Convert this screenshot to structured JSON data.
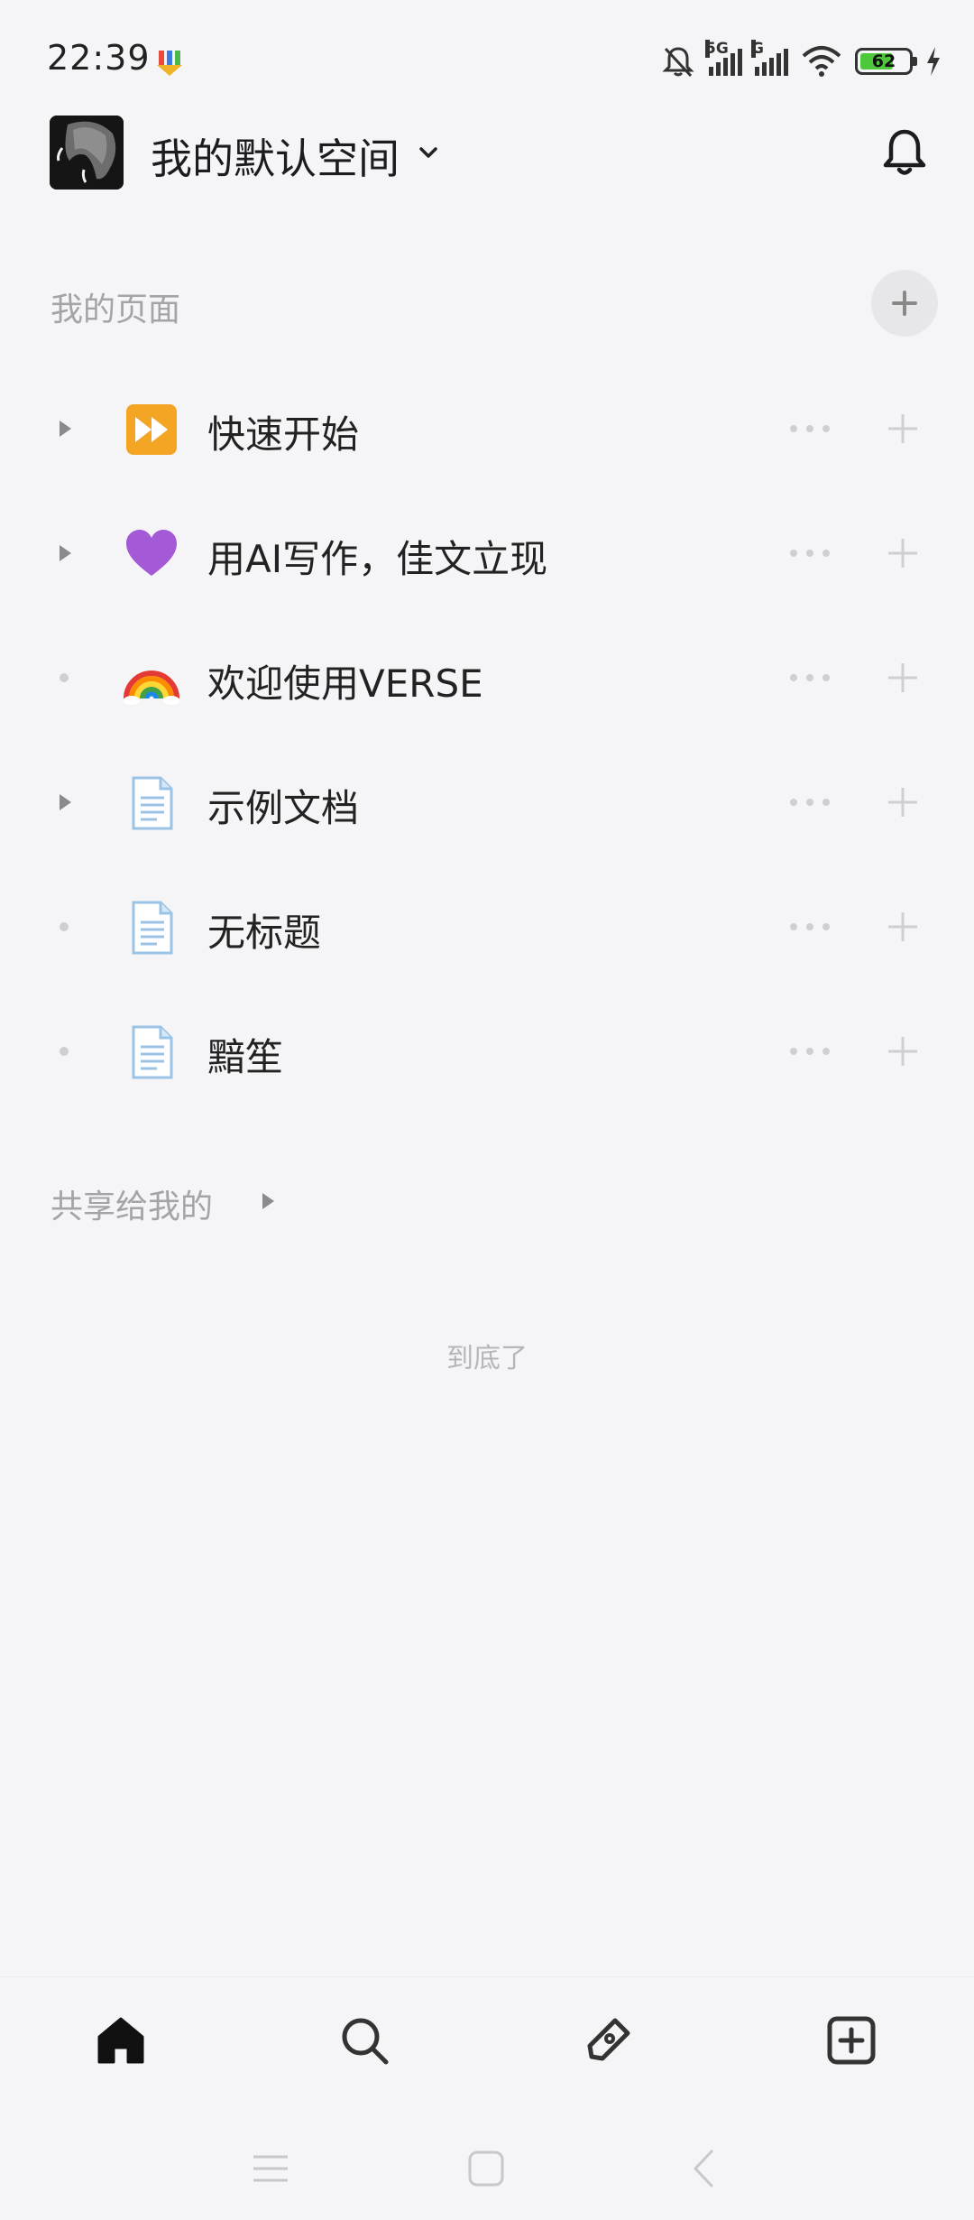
{
  "status_bar": {
    "time": "22:39",
    "network_1": "5G",
    "network_2": "G",
    "battery_level": "62",
    "icons": [
      "app-notification-icon",
      "mute-bell-icon",
      "signal-icon",
      "wifi-icon",
      "battery-icon",
      "charging-icon"
    ]
  },
  "header": {
    "space_name": "我的默认空间",
    "icons": [
      "avatar",
      "chevron-down-icon",
      "bell-icon"
    ]
  },
  "my_pages": {
    "label": "我的页面",
    "items": [
      {
        "title": "快速开始",
        "icon": "fast-forward-icon",
        "expandable": true
      },
      {
        "title": "用AI写作，佳文立现",
        "icon": "purple-heart-icon",
        "expandable": true
      },
      {
        "title": "欢迎使用VERSE",
        "icon": "rainbow-icon",
        "expandable": false
      },
      {
        "title": "示例文档",
        "icon": "document-icon",
        "expandable": true
      },
      {
        "title": "无标题",
        "icon": "document-icon",
        "expandable": false
      },
      {
        "title": "黯笙",
        "icon": "document-icon",
        "expandable": false
      }
    ]
  },
  "shared": {
    "label": "共享给我的"
  },
  "end_text": "到底了",
  "bottom_nav": [
    "home-icon",
    "search-icon",
    "edit-icon",
    "add-page-icon"
  ],
  "colors": {
    "background": "#f5f5f7",
    "muted_text": "#a3a3a8",
    "battery_fill": "#4cc83a"
  }
}
